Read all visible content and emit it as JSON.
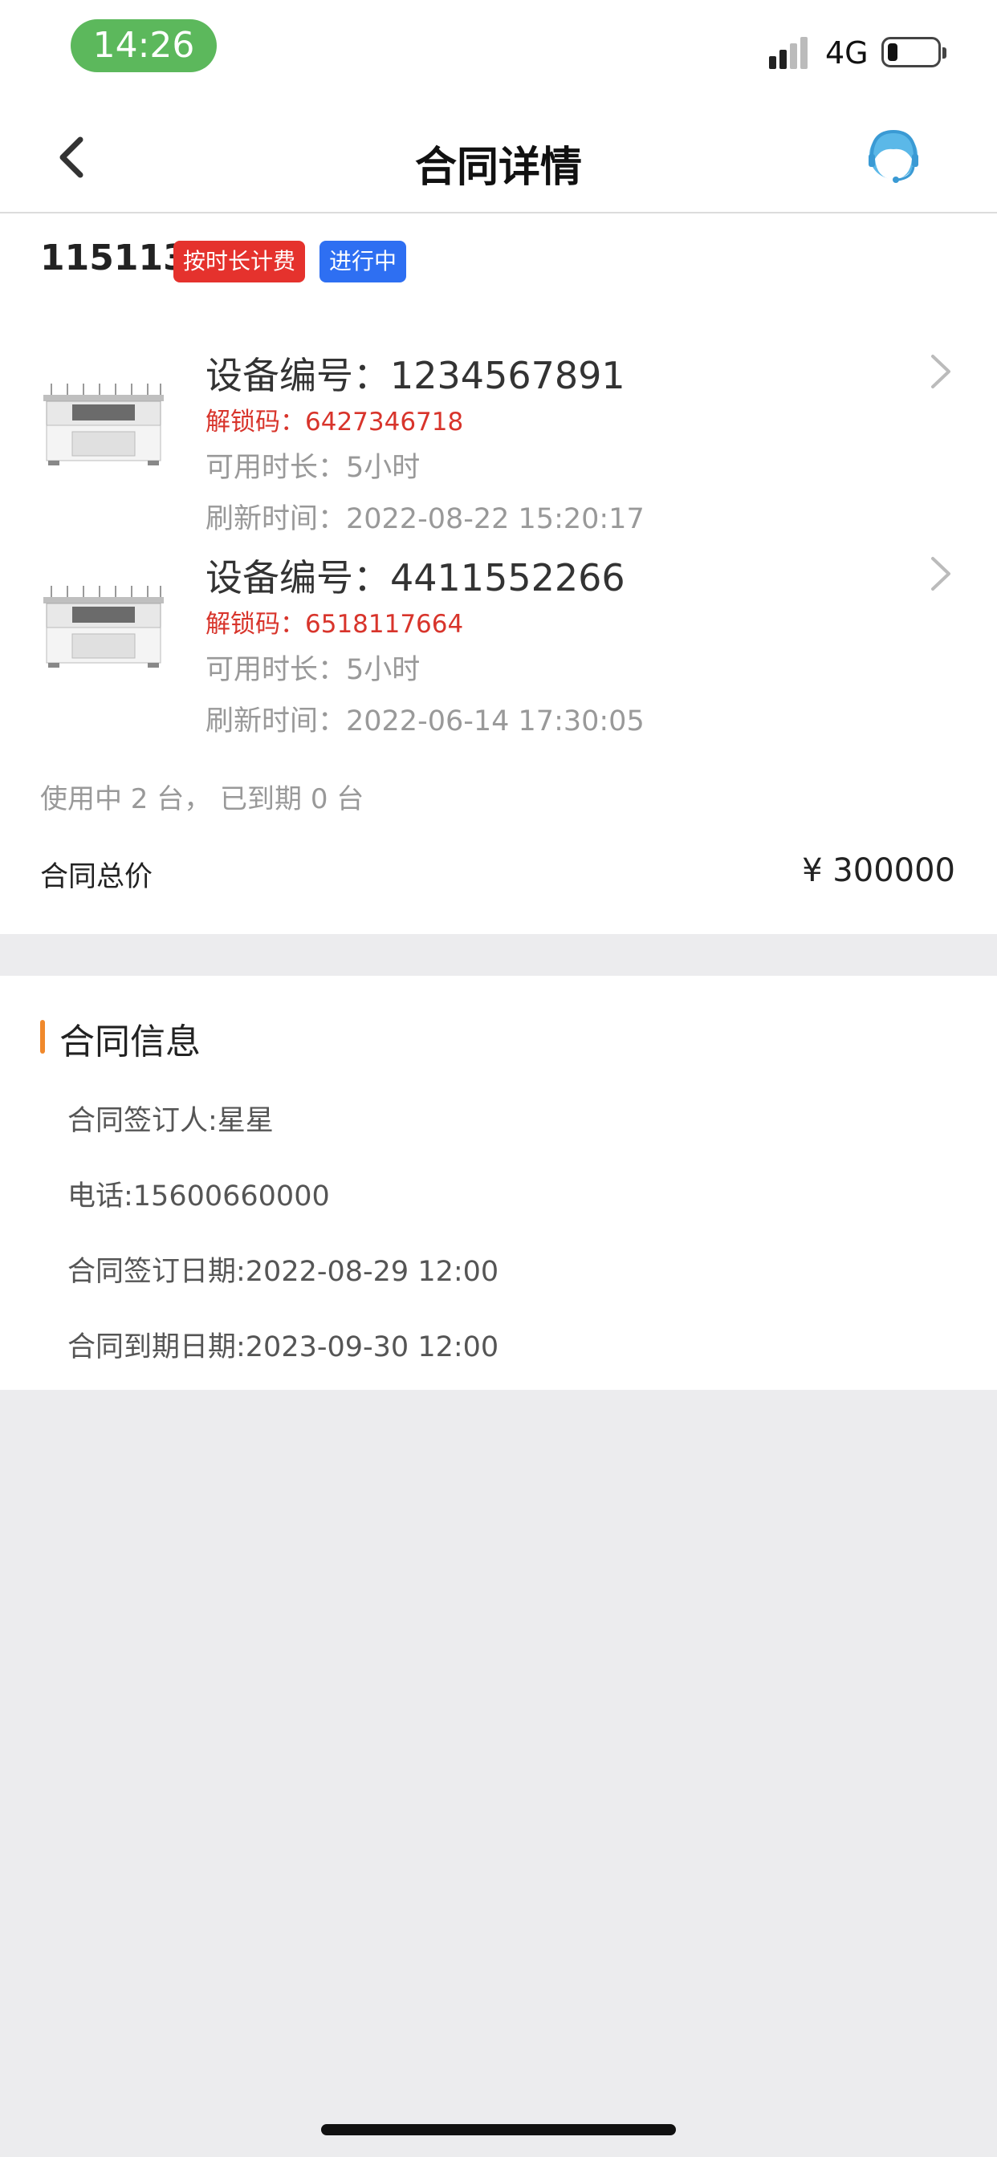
{
  "status": {
    "time": "14:26",
    "network": "4G",
    "battery_level": 0.2
  },
  "nav": {
    "title": "合同详情",
    "back_icon": "chevron-left-icon",
    "service_icon": "customer-service-icon"
  },
  "contract": {
    "number": "115113",
    "tags": [
      {
        "label": "按时长计费",
        "color": "#e5322d"
      },
      {
        "label": "进行中",
        "color": "#2e6ff2"
      }
    ],
    "devices": [
      {
        "device_no": "设备编号：1234567891",
        "unlock_code": "解锁码：6427346718",
        "available_hours": "可用时长：5小时",
        "refresh_time": "刷新时间：2022-08-22 15:20:17"
      },
      {
        "device_no": "设备编号：4411552266",
        "unlock_code": "解锁码：6518117664",
        "available_hours": "可用时长：5小时",
        "refresh_time": "刷新时间：2022-06-14 17:30:05"
      }
    ],
    "usage_summary": "使用中 2 台， 已到期 0 台",
    "total_label": "合同总价",
    "total_value": "¥  300000"
  },
  "info": {
    "title": "合同信息",
    "accent_color": "#f0892c",
    "signer": "合同签订人:星星",
    "phone": "电话:15600660000",
    "sign_date": "合同签订日期:2022-08-29 12:00",
    "expire_date": "合同到期日期:2023-09-30 12:00"
  }
}
